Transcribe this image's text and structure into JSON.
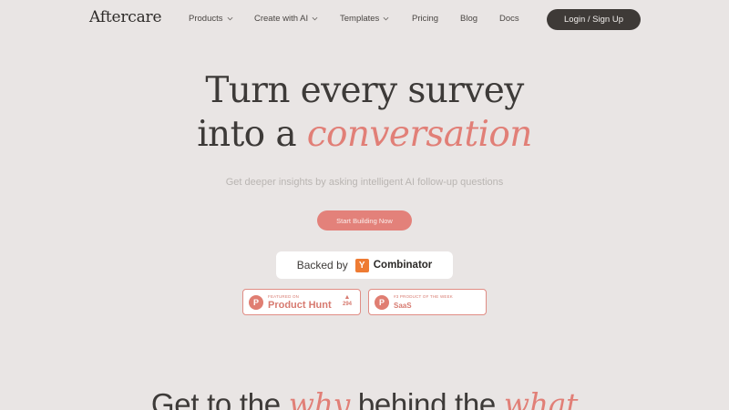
{
  "nav": {
    "logo": "Aftercare",
    "items": [
      {
        "label": "Products",
        "dropdown": true
      },
      {
        "label": "Create with AI",
        "dropdown": true
      },
      {
        "label": "Templates",
        "dropdown": true
      },
      {
        "label": "Pricing",
        "dropdown": false
      },
      {
        "label": "Blog",
        "dropdown": false
      },
      {
        "label": "Docs",
        "dropdown": false
      }
    ],
    "login_label": "Login / Sign Up"
  },
  "hero": {
    "title_line1": "Turn every survey",
    "title_line2_plain": "into a ",
    "title_line2_accent": "conversation",
    "subtitle": "Get deeper insights by asking intelligent AI follow-up questions",
    "cta_label": "Start Building Now"
  },
  "backed": {
    "prefix": "Backed by",
    "logo_letter": "Y",
    "name": "Combinator"
  },
  "badges": [
    {
      "small": "FEATURED ON",
      "big": "Product Hunt",
      "letter": "P",
      "upvotes": "294",
      "icon": "upvote-triangle"
    },
    {
      "small": "#3 PRODUCT OF THE WEEK",
      "big": "SaaS",
      "letter": "P"
    }
  ],
  "section": {
    "part1": "Get to the ",
    "accent1": "why",
    "part2": " behind the ",
    "accent2": "what"
  },
  "colors": {
    "background": "#e9e5e4",
    "accent": "#e17f77",
    "dark_button": "#3e3a37",
    "yc_orange": "#ee7b33"
  }
}
